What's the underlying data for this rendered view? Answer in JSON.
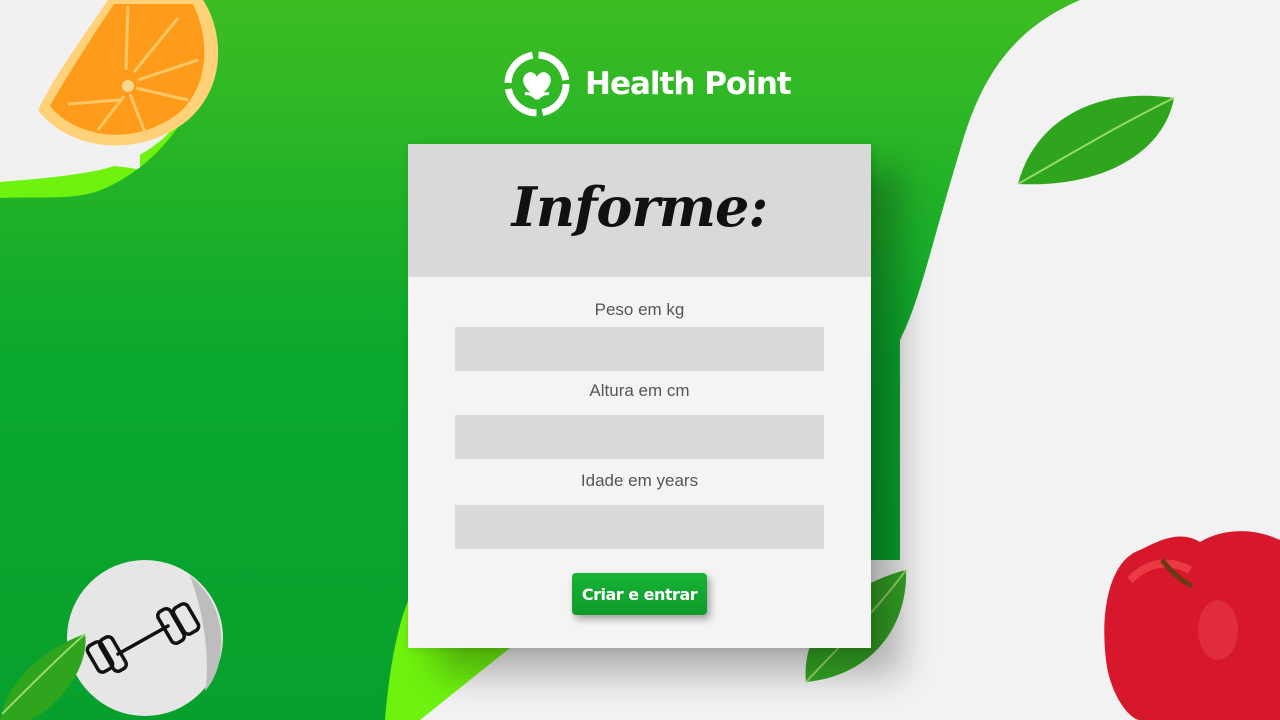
{
  "brand": {
    "name": "Health Point",
    "logo_icon": "heart-sprout-icon"
  },
  "form": {
    "title": "Informe:",
    "fields": [
      {
        "label": "Peso em kg",
        "value": "",
        "placeholder": ""
      },
      {
        "label": "Altura em cm",
        "value": "",
        "placeholder": ""
      },
      {
        "label": "Idade em years",
        "value": "",
        "placeholder": ""
      }
    ],
    "submit_label": "Criar e entrar"
  },
  "decorations": {
    "fitness_sticker_icon": "dumbbell-icon",
    "fruit_images": [
      "orange-slice",
      "apple",
      "green-leaf"
    ]
  },
  "colors": {
    "brand_green": "#0ca82c",
    "accent_lime": "#7df20a",
    "header_gray": "#d9d9d9",
    "card_bg": "#f4f4f4",
    "input_bg": "#dadada",
    "button_green": "#14ad33"
  }
}
